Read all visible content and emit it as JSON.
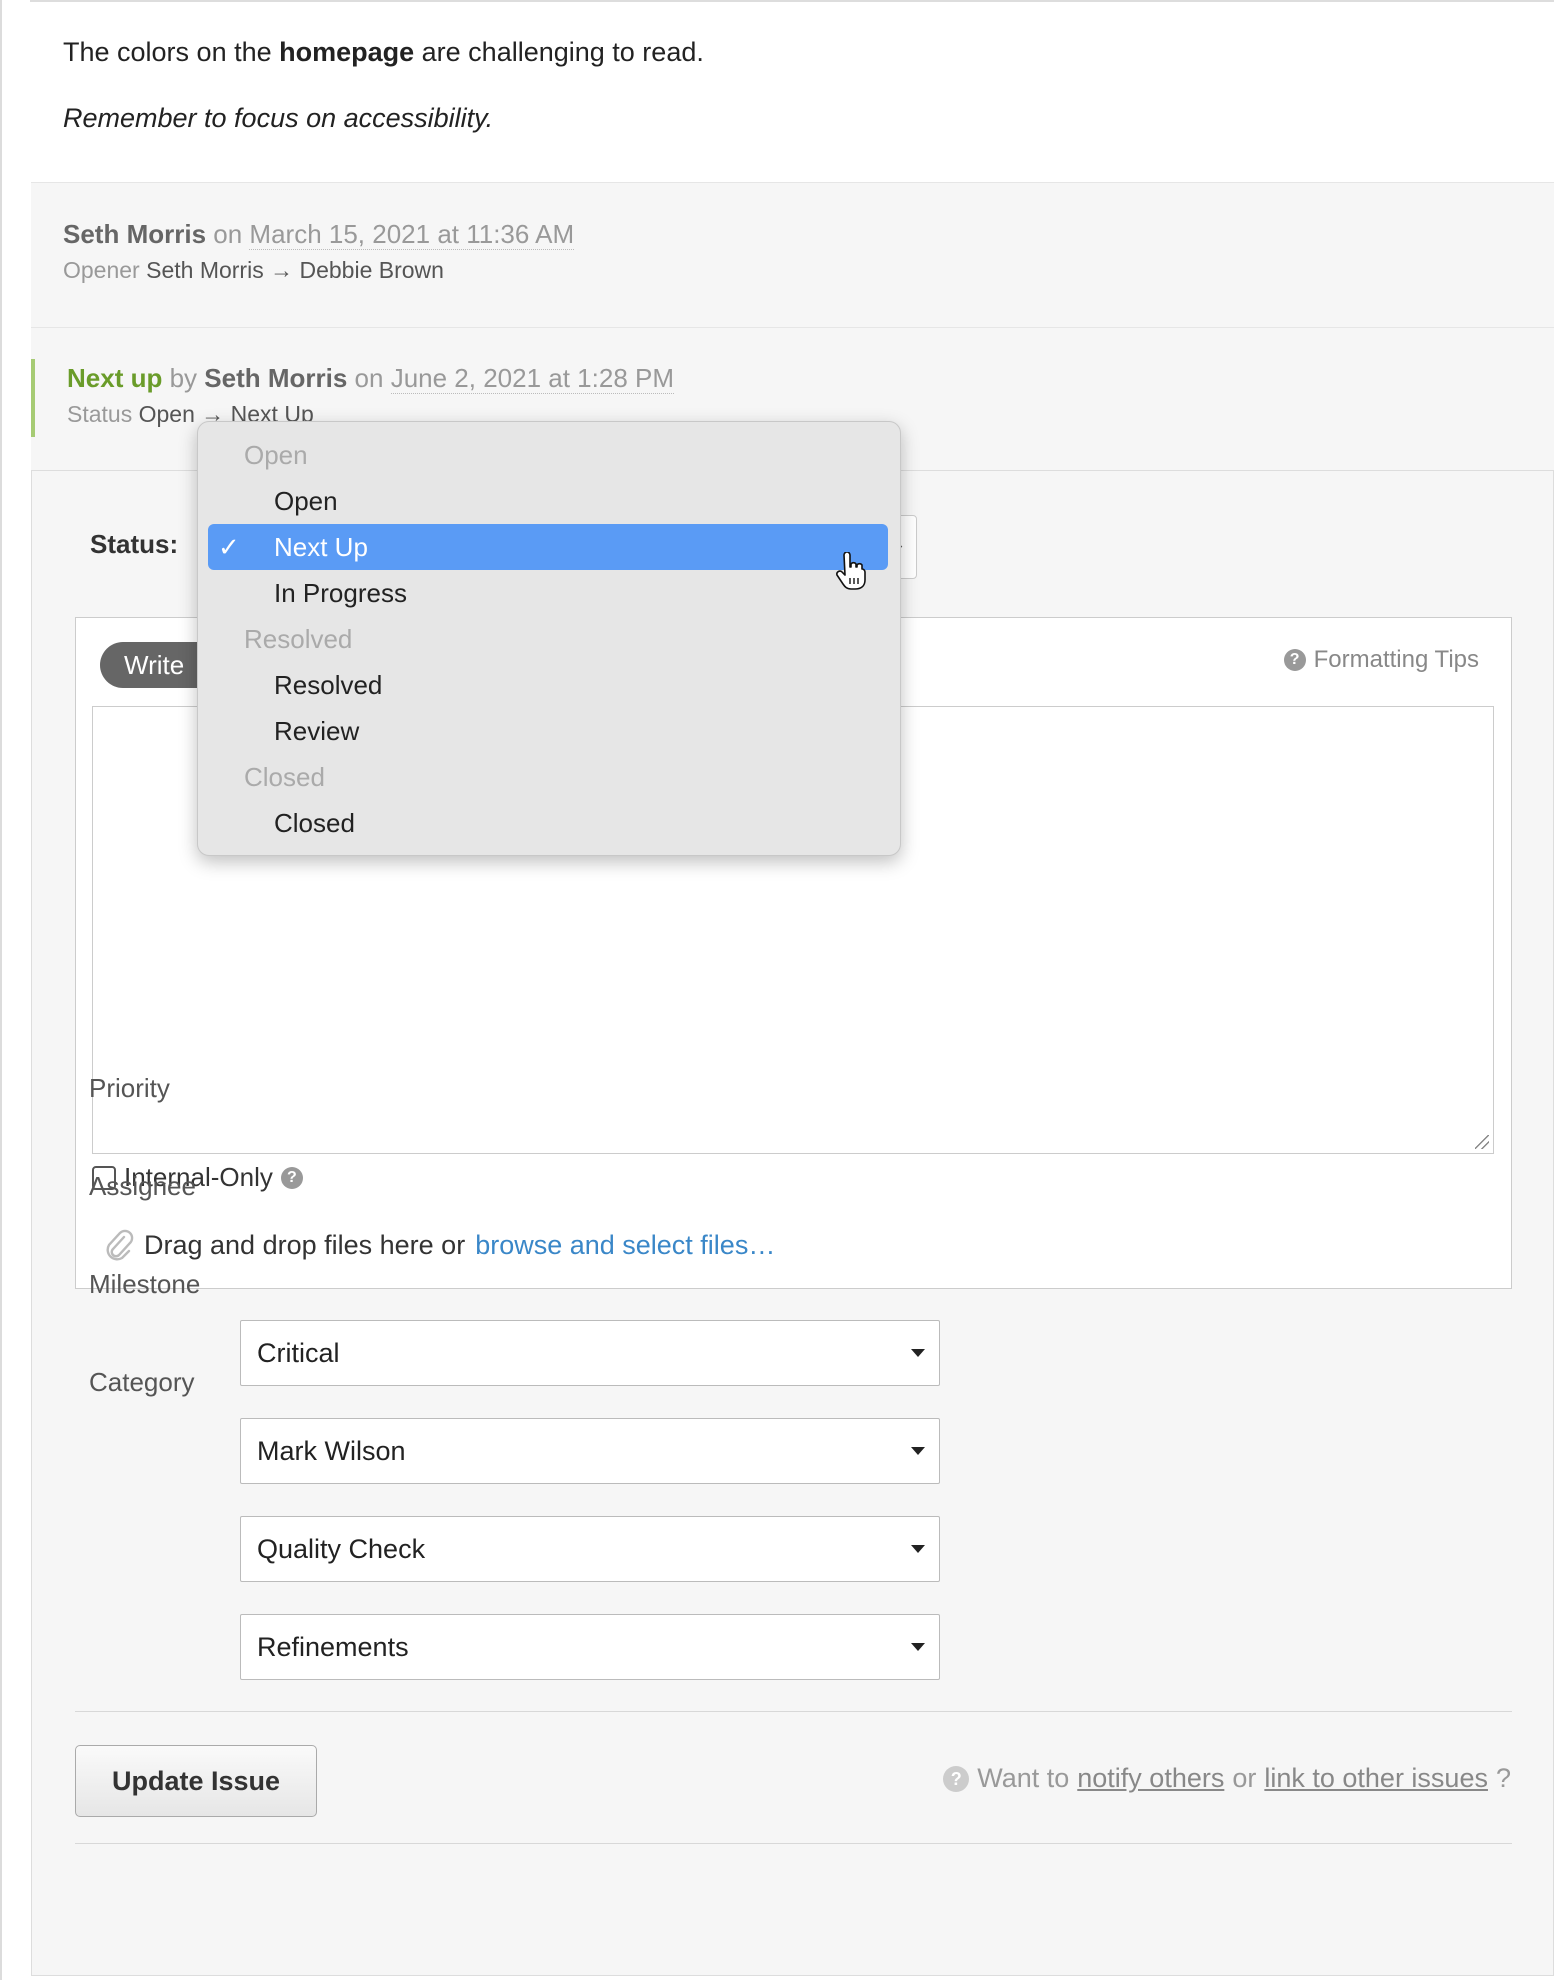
{
  "comment": {
    "line1_pre": "The colors on the ",
    "line1_bold": "homepage",
    "line1_post": " are challenging to read.",
    "line2": "Remember to focus on accessibility."
  },
  "events": [
    {
      "author": "Seth Morris",
      "on": "on",
      "date": "March 15, 2021 at 11:36 AM",
      "field": "Opener",
      "from": "Seth Morris",
      "arrow": "→",
      "to": "Debbie Brown"
    },
    {
      "status": "Next up",
      "by": "by",
      "author": "Seth Morris",
      "on": "on",
      "date": "June 2, 2021 at 1:28 PM",
      "field": "Status",
      "from": "Open",
      "arrow": "→",
      "to": "Next Up"
    }
  ],
  "form": {
    "status_label": "Status:",
    "write_tab": "Write",
    "formatting_tips": "Formatting Tips",
    "internal_only": "Internal-Only",
    "attach_text": "Drag and drop files here or ",
    "attach_link": "browse and select files…",
    "fields": [
      {
        "label": "Priority",
        "value": "Critical"
      },
      {
        "label": "Assignee",
        "value": "Mark Wilson"
      },
      {
        "label": "Milestone",
        "value": "Quality Check"
      },
      {
        "label": "Category",
        "value": "Refinements"
      }
    ],
    "update_button": "Update Issue",
    "notify_pre": "Want to ",
    "notify_link1": "notify others",
    "notify_mid": " or ",
    "notify_link2": "link to other issues",
    "notify_post": "?"
  },
  "dropdown": {
    "items": [
      {
        "type": "group",
        "label": "Open"
      },
      {
        "type": "option",
        "label": "Open"
      },
      {
        "type": "option",
        "label": "Next Up",
        "selected": true
      },
      {
        "type": "option",
        "label": "In Progress"
      },
      {
        "type": "group",
        "label": "Resolved"
      },
      {
        "type": "option",
        "label": "Resolved"
      },
      {
        "type": "option",
        "label": "Review"
      },
      {
        "type": "group",
        "label": "Closed"
      },
      {
        "type": "option",
        "label": "Closed"
      }
    ],
    "check_glyph": "✓"
  },
  "icons": {
    "help": "question-circle-icon",
    "attach": "paperclip-icon",
    "caret": "caret-down-icon",
    "cursor": "pointer-hand-icon"
  },
  "colors": {
    "status_green": "#6a9c2a",
    "link_blue": "#3a87c8",
    "selection_blue": "#5a9bf5"
  }
}
